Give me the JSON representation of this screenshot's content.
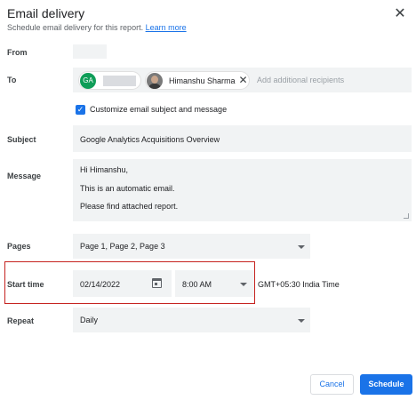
{
  "dialog": {
    "title": "Email delivery",
    "subtitle": "Schedule email delivery for this report.",
    "learn_more": "Learn more",
    "close_icon": "✕"
  },
  "from": {
    "label": "From"
  },
  "to": {
    "label": "To",
    "recipients": [
      {
        "initials": "GA",
        "avatar_color": "#0f9d58"
      },
      {
        "name": "Himanshu Sharma",
        "remove_icon": "✕"
      }
    ],
    "placeholder": "Add additional recipients"
  },
  "customize": {
    "label": "Customize email subject and message",
    "checked": true,
    "check_icon": "✓"
  },
  "subject": {
    "label": "Subject",
    "value": "Google Analytics Acquisitions Overview"
  },
  "message": {
    "label": "Message",
    "lines": [
      "Hi Himanshu,",
      "This is an automatic email.",
      "Please find attached report."
    ]
  },
  "pages": {
    "label": "Pages",
    "value": "Page 1, Page 2, Page 3"
  },
  "start_time": {
    "label": "Start time",
    "date": "02/14/2022",
    "time": "8:00 AM",
    "timezone": "GMT+05:30 India Time"
  },
  "repeat": {
    "label": "Repeat",
    "value": "Daily"
  },
  "buttons": {
    "cancel": "Cancel",
    "schedule": "Schedule"
  },
  "colors": {
    "accent": "#1a73e8",
    "highlight_border": "#c5221f",
    "field_bg": "#f1f3f4"
  }
}
